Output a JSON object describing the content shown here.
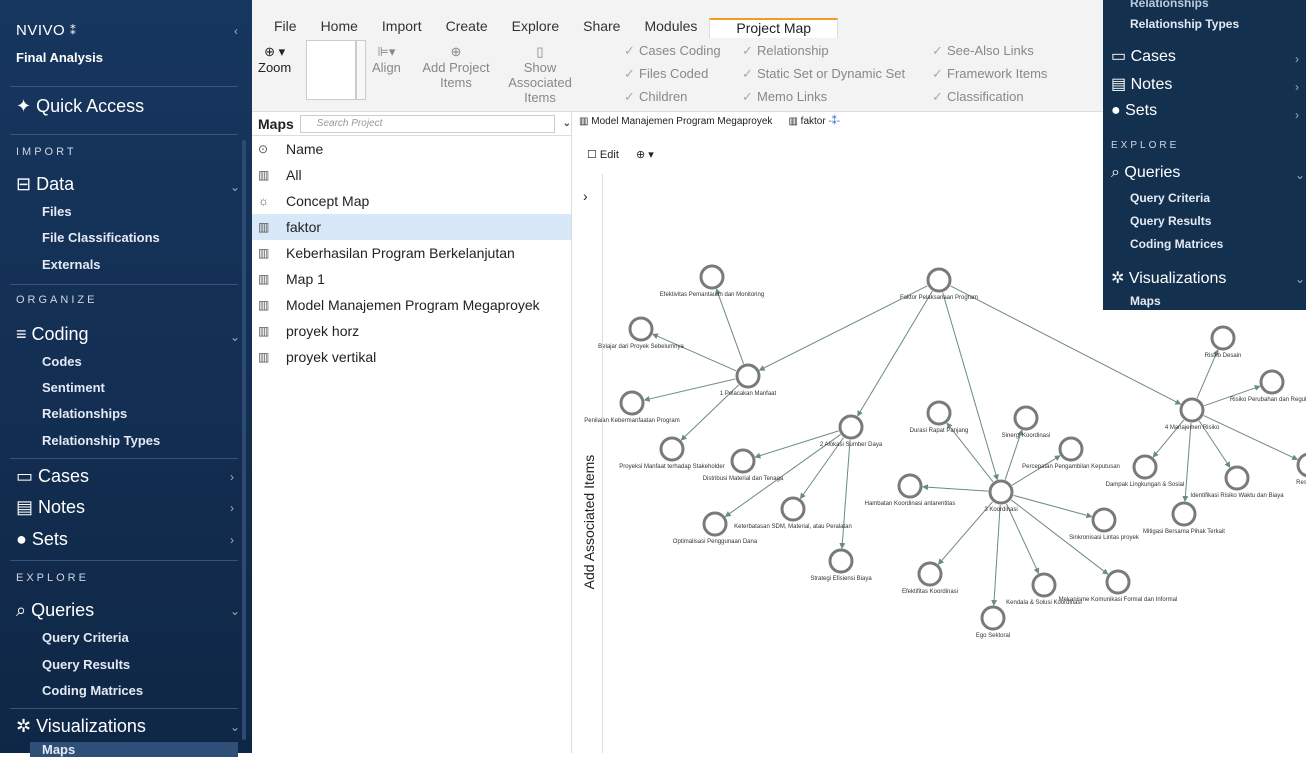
{
  "app": {
    "brand": "NVIVO",
    "project": "Final Analysis"
  },
  "sidebar": {
    "quick": "Quick Access",
    "import": "IMPORT",
    "data": "Data",
    "files": "Files",
    "file_class": "File Classifications",
    "externals": "Externals",
    "organize": "ORGANIZE",
    "coding": "Coding",
    "codes": "Codes",
    "sentiment": "Sentiment",
    "relationships": "Relationships",
    "rel_types": "Relationship Types",
    "cases": "Cases",
    "notes": "Notes",
    "sets": "Sets",
    "explore": "EXPLORE",
    "queries": "Queries",
    "q_criteria": "Query Criteria",
    "q_results": "Query Results",
    "coding_matrices": "Coding Matrices",
    "visualizations": "Visualizations",
    "maps": "Maps"
  },
  "ribbon": {
    "tabs": [
      "File",
      "Home",
      "Import",
      "Create",
      "Explore",
      "Share",
      "Modules",
      "Project Map"
    ],
    "zoom": "Zoom",
    "align": "Align",
    "add_project": "Add Project Items",
    "show_assoc": "Show Associated Items",
    "checks": [
      "Cases Coding",
      "Files Coded",
      "Children",
      "Relationship",
      "Static Set or Dynamic Set",
      "Memo Links",
      "See-Also Links",
      "Framework Items",
      "Classification"
    ]
  },
  "maps_panel": {
    "title": "Maps",
    "search_placeholder": "Search Project",
    "col_name": "Name",
    "items": [
      "All",
      "Concept Map",
      "faktor",
      "Keberhasilan Program Berkelanjutan",
      "Map 1",
      "Model Manajemen Program Megaproyek",
      "proyek horz",
      "proyek vertikal"
    ]
  },
  "doc_tabs": [
    "Model Manajemen Program Megaproyek",
    "faktor"
  ],
  "edit": "Edit",
  "add_assoc": "Add Associated Items",
  "flyout": {
    "relationships": "Relationships",
    "rel_types": "Relationship Types",
    "cases": "Cases",
    "notes": "Notes",
    "sets": "Sets",
    "explore": "EXPLORE",
    "queries": "Queries",
    "q_criteria": "Query Criteria",
    "q_results": "Query Results",
    "coding_matrices": "Coding Matrices",
    "visualizations": "Visualizations",
    "maps": "Maps"
  },
  "nodes": [
    {
      "id": "faktor",
      "label": "Faktor Pelaksanaan Program"
    },
    {
      "id": "n1",
      "label": "1 Pelacakan Manfaat"
    },
    {
      "id": "efektivitas",
      "label": "Efektivitas Pemantauan dan Monitoring"
    },
    {
      "id": "belajar",
      "label": "Belajar dari Proyek Sebelumnya"
    },
    {
      "id": "penilaian",
      "label": "Penilaian Kebermanfaatan Program"
    },
    {
      "id": "proyeksi",
      "label": "Proyeksi Manfaat terhadap Stakeholder"
    },
    {
      "id": "n2",
      "label": "2 Alokasi Sumber Daya"
    },
    {
      "id": "distribusi",
      "label": "Distribusi Material dan Tenaga"
    },
    {
      "id": "keterbatasan",
      "label": "Keterbatasan SDM, Material, atau Peralatan"
    },
    {
      "id": "optimalisasi",
      "label": "Optimalisasi Penggunaan Dana"
    },
    {
      "id": "strategi",
      "label": "Strategi Efisiensi Biaya"
    },
    {
      "id": "n3",
      "label": "3 Koordinasi"
    },
    {
      "id": "durasi",
      "label": "Durasi Rapat Panjang"
    },
    {
      "id": "sinergi",
      "label": "Sinergi Koordinasi"
    },
    {
      "id": "percepatan",
      "label": "Percepatan Pengambilan Keputusan"
    },
    {
      "id": "hambatan",
      "label": "Hambatan Koordinasi antarentitas"
    },
    {
      "id": "sinkronisasi",
      "label": "Sinkronisasi Lintas proyek"
    },
    {
      "id": "efektifitas",
      "label": "Efektifitas Koordinasi"
    },
    {
      "id": "kendala",
      "label": "Kendala & Solusi Koordinasi"
    },
    {
      "id": "mekanisme",
      "label": "Mekanisme Komunikasi Formal dan Informal"
    },
    {
      "id": "ego",
      "label": "Ego Sektoral"
    },
    {
      "id": "n4",
      "label": "4 Manajemen Risiko"
    },
    {
      "id": "risikodesain",
      "label": "Risiko Desain"
    },
    {
      "id": "risikoperubahan",
      "label": "Risiko Perubahan dan Regulasi"
    },
    {
      "id": "dampak",
      "label": "Dampak Lingkungan & Sosial"
    },
    {
      "id": "identifikasi",
      "label": "Identifikasi Risiko Waktu dan Biaya"
    },
    {
      "id": "mitigasi",
      "label": "Mitigasi Bersama Pihak Terkait"
    },
    {
      "id": "respon",
      "label": "Respo La"
    }
  ]
}
